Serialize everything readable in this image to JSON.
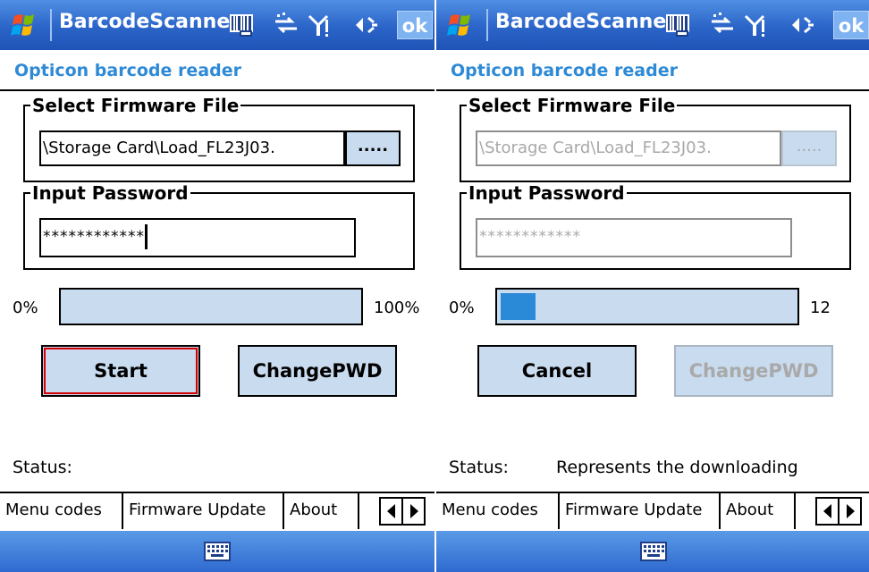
{
  "panels": [
    {
      "titlebar": {
        "title": "BarcodeScanner",
        "ok_label": "ok",
        "icons": [
          "windows-logo",
          "barcode-icon",
          "connectivity-icon",
          "signal-icon",
          "volume-icon"
        ]
      },
      "subtitle": "Opticon barcode reader",
      "firmware_group": {
        "legend": "Select Firmware File",
        "file_path": "\\Storage Card\\Load_FL23J03.",
        "browse_label": "....."
      },
      "password_group": {
        "legend": "Input Password",
        "value": "************"
      },
      "progress": {
        "min_label": "0%",
        "max_label": "100%",
        "fraction": 0
      },
      "buttons": {
        "primary": "Start",
        "secondary": "ChangePWD"
      },
      "status": {
        "label": "Status:",
        "text": ""
      },
      "tabs": [
        "Menu codes",
        "Firmware Update",
        "About"
      ],
      "active_tab": "Firmware Update"
    },
    {
      "titlebar": {
        "title": "BarcodeScanner",
        "ok_label": "ok",
        "icons": [
          "windows-logo",
          "barcode-icon",
          "connectivity-icon",
          "signal-icon",
          "volume-icon"
        ]
      },
      "subtitle": "Opticon barcode reader",
      "firmware_group": {
        "legend": "Select Firmware File",
        "file_path": "\\Storage Card\\Load_FL23J03.",
        "browse_label": "....."
      },
      "password_group": {
        "legend": "Input Password",
        "value": "************"
      },
      "progress": {
        "min_label": "0%",
        "max_label": "12",
        "fraction": 0.12
      },
      "buttons": {
        "primary": "Cancel",
        "secondary": "ChangePWD"
      },
      "status": {
        "label": "Status:",
        "text": "Represents the downloading"
      },
      "tabs": [
        "Menu codes",
        "Firmware Update",
        "About"
      ],
      "active_tab": "Firmware Update"
    }
  ],
  "colors": {
    "titlebar": "#2b64c8",
    "subtitle": "#2f8ad6",
    "control_fill": "#c9dbef",
    "progress_fill": "#2b8ad8",
    "focus": "#d40000"
  }
}
